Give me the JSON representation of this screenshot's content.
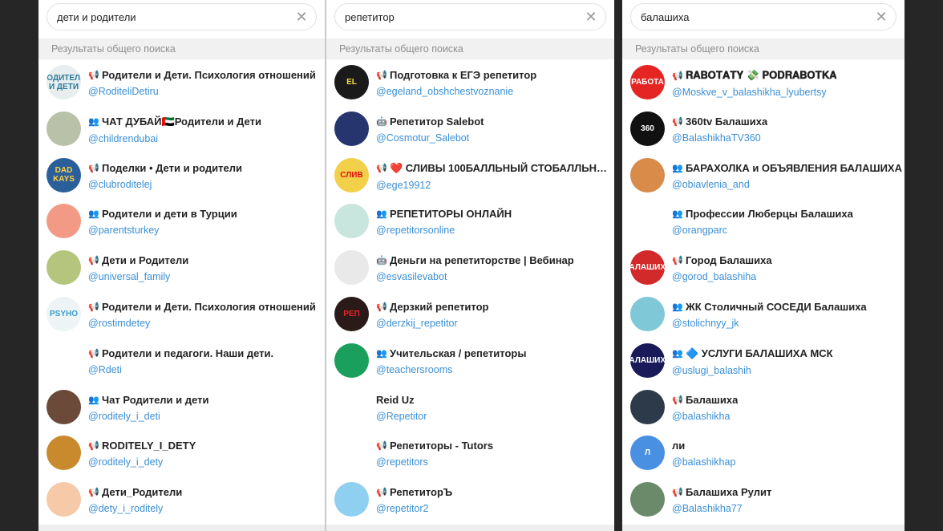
{
  "panels": [
    {
      "query": "дети и родители",
      "section": "Результаты общего поиска",
      "results": [
        {
          "title": "Родители и Дети. Психология отношений",
          "handle": "@RoditeliDetiru",
          "kind": "channel",
          "avatar_color": "#e8eef0",
          "avatar_text": "РОДИТЕЛИ И ДЕТИ",
          "avatar_fg": "#2a7a9a"
        },
        {
          "title": "ЧАТ ДУБАЙ🇦🇪Родители и Дети",
          "handle": "@childrendubai",
          "kind": "group",
          "avatar_color": "#b9c2a8",
          "avatar_text": "",
          "avatar_fg": "#fff"
        },
        {
          "title": "Поделки • Дети и родители",
          "handle": "@clubroditelej",
          "kind": "channel",
          "avatar_color": "#2b5f9a",
          "avatar_text": "DAD KAYS",
          "avatar_fg": "#ffd23f"
        },
        {
          "title": "Родители и дети в Турции",
          "handle": "@parentsturkey",
          "kind": "group",
          "avatar_color": "#f29a86",
          "avatar_text": "",
          "avatar_fg": "#fff"
        },
        {
          "title": "Дети и Родители",
          "handle": "@universal_family",
          "kind": "channel",
          "avatar_color": "#b6c57e",
          "avatar_text": "",
          "avatar_fg": "#fff"
        },
        {
          "title": "Родители и Дети. Психология отношений",
          "handle": "@rostimdetey",
          "kind": "channel",
          "avatar_color": "#eef3f6",
          "avatar_text": "PSYHO",
          "avatar_fg": "#3aa0c8"
        },
        {
          "title": "Родители и педагоги. Наши дети.",
          "handle": "@Rdeti",
          "kind": "channel",
          "avatar_color": "#ffffff",
          "avatar_text": "",
          "avatar_fg": "#c33"
        },
        {
          "title": "Чат Родители и дети",
          "handle": "@roditely_i_deti",
          "kind": "group",
          "avatar_color": "#6b4a3a",
          "avatar_text": "",
          "avatar_fg": "#fff"
        },
        {
          "title": "RODITELY_I_DETY",
          "handle": "@roditely_i_dety",
          "kind": "channel",
          "avatar_color": "#c98a2e",
          "avatar_text": "",
          "avatar_fg": "#2a1a0a"
        },
        {
          "title": "Дети_Родители",
          "handle": "@dety_i_roditely",
          "kind": "channel",
          "avatar_color": "#f6c9a8",
          "avatar_text": "",
          "avatar_fg": "#fff"
        }
      ]
    },
    {
      "query": "репетитор",
      "section": "Результаты общего поиска",
      "results": [
        {
          "title": "Подготовка к ЕГЭ репетитор",
          "handle": "@egeland_obshchestvoznanie",
          "kind": "channel",
          "avatar_color": "#1a1a1a",
          "avatar_text": "EL",
          "avatar_fg": "#f7e23b"
        },
        {
          "title": "Репетитор Salebot",
          "handle": "@Cosmotur_Salebot",
          "kind": "bot",
          "avatar_color": "#27356e",
          "avatar_text": "",
          "avatar_fg": "#fff"
        },
        {
          "title": "❤️ СЛИВЫ 100БАЛЛЬНЫЙ СТОБАЛЛЬНЫЙ ...",
          "handle": "@ege19912",
          "kind": "channel",
          "avatar_color": "#f2d04a",
          "avatar_text": "СЛИВ",
          "avatar_fg": "#d11"
        },
        {
          "title": "РЕПЕТИТОРЫ ОНЛАЙН",
          "handle": "@repetitorsonline",
          "kind": "group",
          "avatar_color": "#c8e6de",
          "avatar_text": "",
          "avatar_fg": "#fff"
        },
        {
          "title": "Деньги на репетиторстве | Вебинар",
          "handle": "@esvasilevabot",
          "kind": "bot",
          "avatar_color": "#e9e9e9",
          "avatar_text": "",
          "avatar_fg": "#333"
        },
        {
          "title": "Дерзкий репетитор",
          "handle": "@derzkij_repetitor",
          "kind": "channel",
          "avatar_color": "#2a1a1a",
          "avatar_text": "РЕП",
          "avatar_fg": "#e22"
        },
        {
          "title": "Учительская / репетиторы",
          "handle": "@teachersrooms",
          "kind": "group",
          "avatar_color": "#1aa05c",
          "avatar_text": "",
          "avatar_fg": "#fff"
        },
        {
          "title": "Reid Uz",
          "handle": "@Repetitor",
          "kind": "none",
          "avatar_color": "#ffffff",
          "avatar_text": "",
          "avatar_fg": "#111"
        },
        {
          "title": "Репетиторы - Tutors",
          "handle": "@repetitors",
          "kind": "channel",
          "avatar_color": "#ffffff",
          "avatar_text": "",
          "avatar_fg": "#6b3a1a"
        },
        {
          "title": "РепетиторЪ",
          "handle": "@repetitor2",
          "kind": "channel",
          "avatar_color": "#8fd0f0",
          "avatar_text": "",
          "avatar_fg": "#fff"
        }
      ]
    },
    {
      "query": "балашиха",
      "section": "Результаты общего поиска",
      "results": [
        {
          "title": "𝐑𝐀𝐁𝐎𝐓𝐀𝐓𝐘 💸 𝐏𝐎𝐃𝐑𝐀𝐁𝐎𝐓𝐊𝐀",
          "handle": "@Moskve_v_balashikha_lyubertsy",
          "kind": "channel",
          "avatar_color": "#e52424",
          "avatar_text": "РАБОТА",
          "avatar_fg": "#fff"
        },
        {
          "title": "360tv Балашиха",
          "handle": "@BalashikhaTV360",
          "kind": "channel",
          "avatar_color": "#111111",
          "avatar_text": "360",
          "avatar_fg": "#fff"
        },
        {
          "title": "БАРАХОЛКА и ОБЪЯВЛЕНИЯ БАЛАШИХА",
          "handle": "@obiavlenia_and",
          "kind": "group",
          "avatar_color": "#d98b4a",
          "avatar_text": "",
          "avatar_fg": "#fff"
        },
        {
          "title": "Профессии Люберцы Балашиха",
          "handle": "@orangparc",
          "kind": "group",
          "avatar_color": "#ffffff",
          "avatar_text": "",
          "avatar_fg": "#222"
        },
        {
          "title": "Город Балашиха",
          "handle": "@gorod_balashiha",
          "kind": "channel",
          "avatar_color": "#d22a2a",
          "avatar_text": "БАЛАШИХА",
          "avatar_fg": "#fff"
        },
        {
          "title": "ЖК Столичный СОСЕДИ Балашиха",
          "handle": "@stolichnyy_jk",
          "kind": "group",
          "avatar_color": "#7ec8d8",
          "avatar_text": "",
          "avatar_fg": "#fff"
        },
        {
          "title": "🔷 УСЛУГИ БАЛАШИХА МСК",
          "handle": "@uslugi_balashih",
          "kind": "group",
          "avatar_color": "#1a1a5a",
          "avatar_text": "БАЛАШИХА",
          "avatar_fg": "#fff"
        },
        {
          "title": "Балашиха",
          "handle": "@balashikha",
          "kind": "channel",
          "avatar_color": "#2c3a4a",
          "avatar_text": "",
          "avatar_fg": "#fff"
        },
        {
          "title": "ли",
          "handle": "@balashikhap",
          "kind": "none",
          "avatar_color": "#4a90e2",
          "avatar_text": "Л",
          "avatar_fg": "#fff"
        },
        {
          "title": "Балашиха Рулит",
          "handle": "@Balashikha77",
          "kind": "channel",
          "avatar_color": "#6a8a6a",
          "avatar_text": "",
          "avatar_fg": "#fff"
        }
      ]
    }
  ],
  "icons": {
    "channel": "megaphone-icon",
    "group": "group-icon",
    "bot": "bot-icon",
    "clear": "clear-search-icon"
  }
}
